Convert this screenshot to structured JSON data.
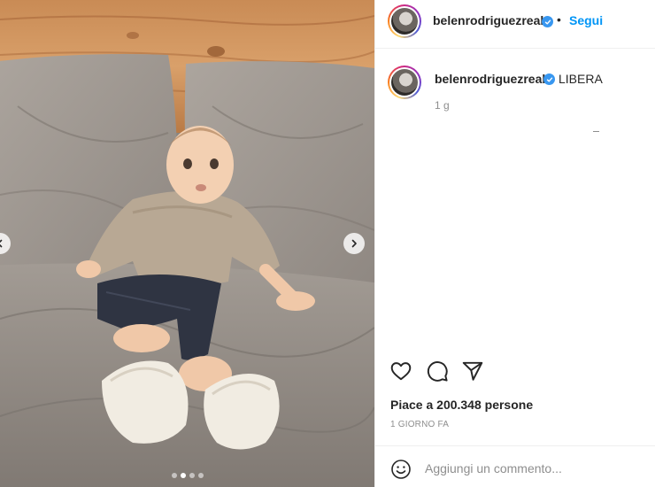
{
  "post": {
    "username": "belenrodriguezreal",
    "follow_label": "Segui",
    "separator": "•",
    "caption": "LIBERA",
    "caption_age": "1 g",
    "likes_text": "Piace a 200.348 persone",
    "date_text": "1 GIORNO FA",
    "comment_placeholder": "Aggiungi un commento...",
    "carousel": {
      "slides": 4,
      "active_index": 1
    }
  },
  "colors": {
    "link": "#0095f6",
    "verified": "#3897f0",
    "muted": "#8e8e8e",
    "text": "#262626"
  },
  "icons": {
    "verified": "verified-badge-icon",
    "like": "heart-icon",
    "comment": "comment-bubble-icon",
    "share": "paper-plane-icon",
    "emoji": "emoji-smiley-icon",
    "next": "chevron-right-icon",
    "prev": "chevron-left-icon"
  }
}
